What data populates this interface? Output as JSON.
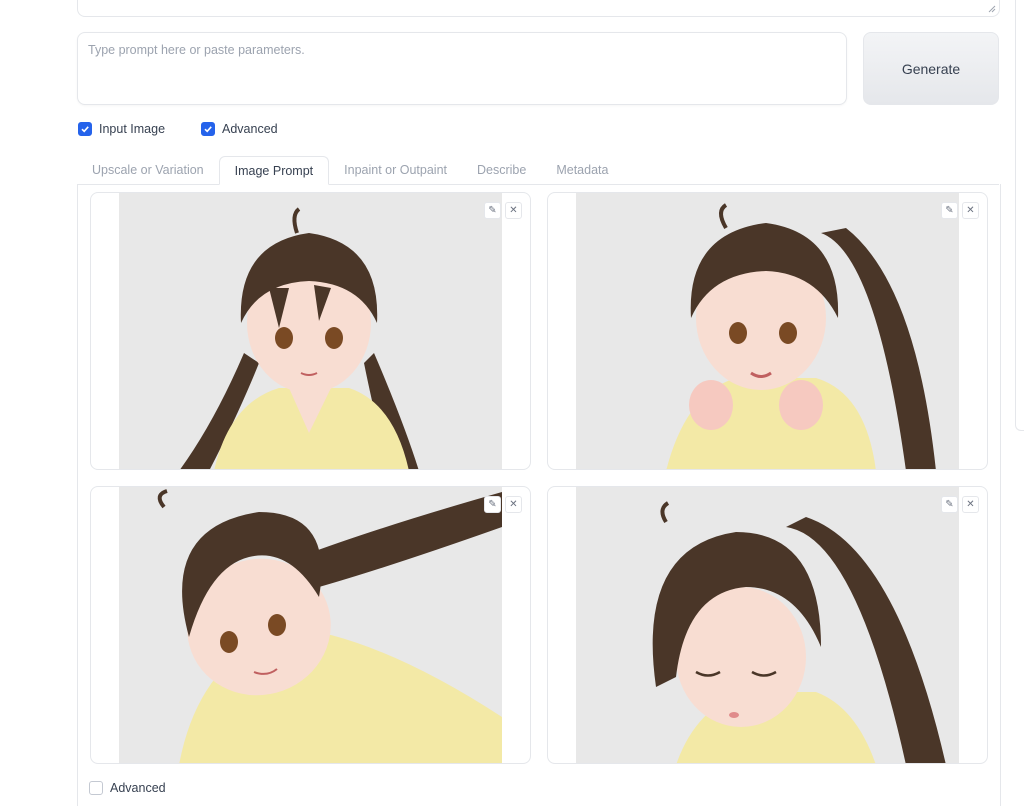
{
  "prompt": {
    "placeholder": "Type prompt here or paste parameters.",
    "value": ""
  },
  "generate": {
    "label": "Generate"
  },
  "options": {
    "input_image": {
      "label": "Input Image",
      "checked": true
    },
    "advanced": {
      "label": "Advanced",
      "checked": true
    }
  },
  "tabs": [
    {
      "label": "Upscale or Variation",
      "active": false
    },
    {
      "label": "Image Prompt",
      "active": true
    },
    {
      "label": "Inpaint or Outpaint",
      "active": false
    },
    {
      "label": "Describe",
      "active": false
    },
    {
      "label": "Metadata",
      "active": false
    }
  ],
  "image_slots": [
    {
      "content": "anime girl, brown twin tails, yellow hoodie, front view"
    },
    {
      "content": "anime girl, brown twin tails, yellow hoodie, fists raised"
    },
    {
      "content": "anime girl, brown twin tails, yellow hoodie, tilted head, hair blowing"
    },
    {
      "content": "anime girl, brown twin tails, yellow hoodie, eyes closed"
    }
  ],
  "slot_buttons": {
    "edit": "edit-icon",
    "clear": "close-icon"
  },
  "bottom_advanced": {
    "label": "Advanced",
    "checked": false
  },
  "colors": {
    "accent": "#2563eb",
    "border": "#e5e7eb",
    "hair": "#4a3628",
    "hoodie": "#f3e9a6",
    "skin": "#f8ddd2"
  }
}
